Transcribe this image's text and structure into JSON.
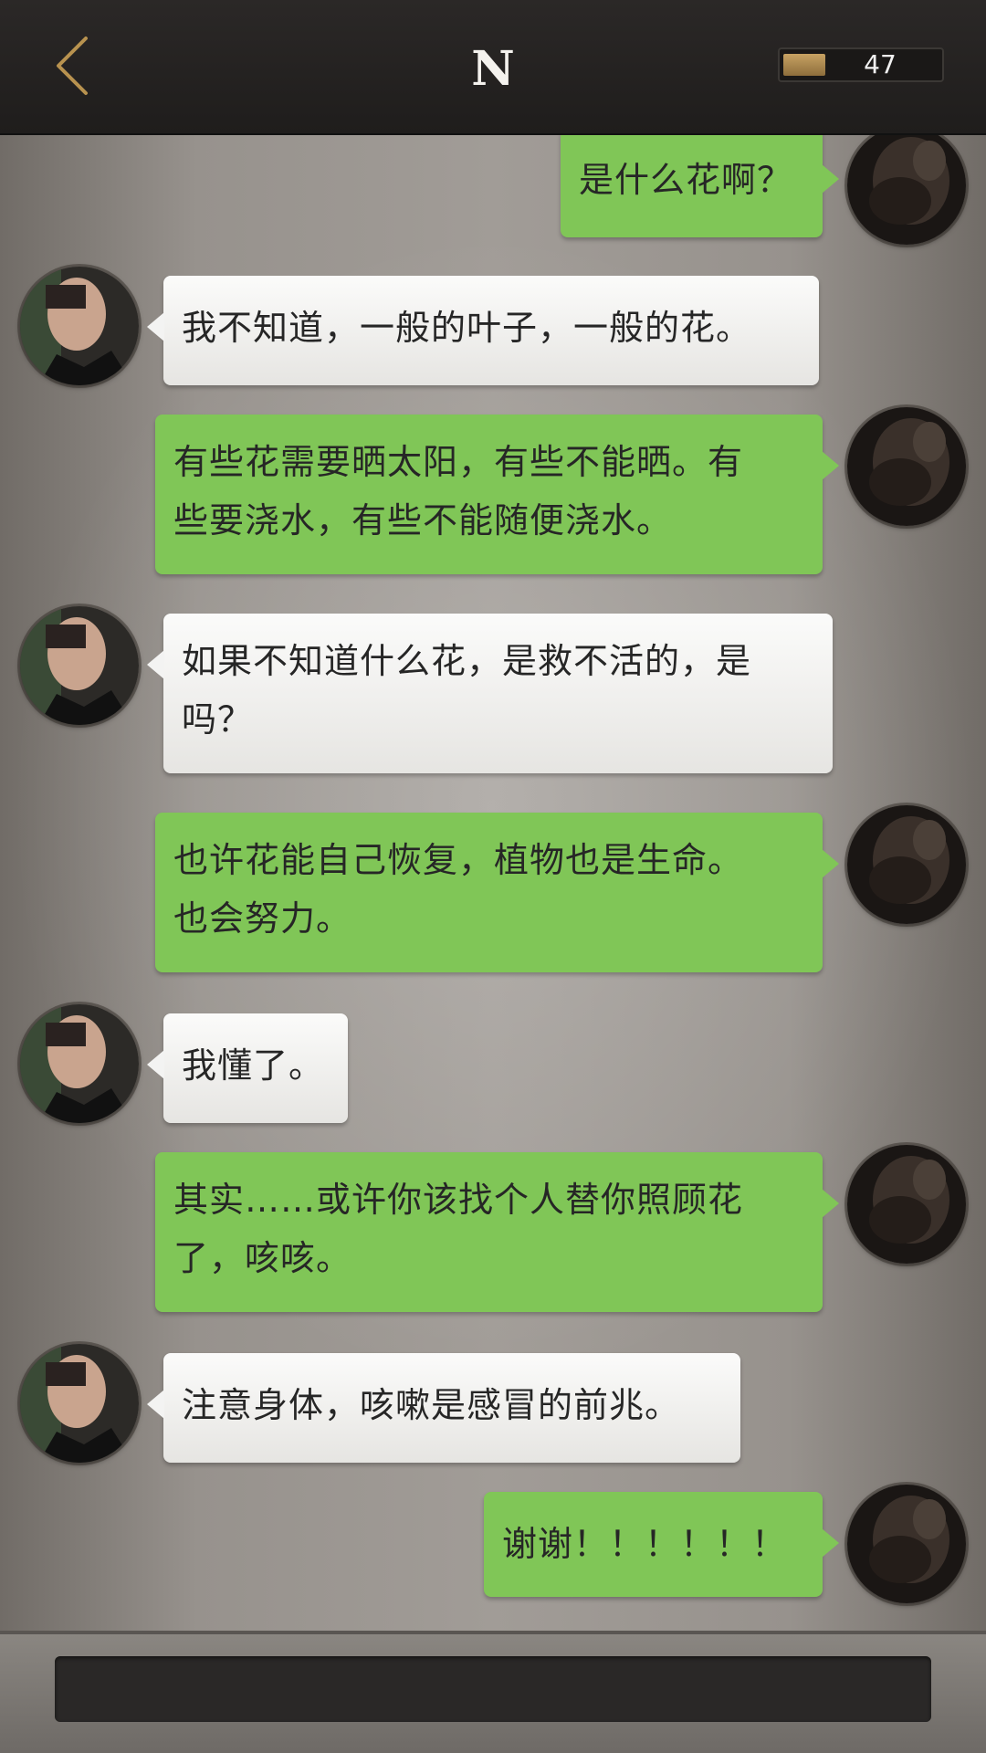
{
  "header": {
    "title": "N",
    "coins": "47"
  },
  "colors": {
    "my_bubble": "#80c657",
    "their_bubble": "#f3f3f2",
    "header_bg": "#1f1d1c",
    "back_arrow": "#b8924f"
  },
  "messages": [
    {
      "sender": "me",
      "lines": [
        "是什么花啊？"
      ]
    },
    {
      "sender": "them",
      "lines": [
        "我不知道，一般的叶子，一般的花。"
      ]
    },
    {
      "sender": "me",
      "lines": [
        "有些花需要晒太阳，有些不能晒。有",
        "些要浇水，有些不能随便浇水。"
      ]
    },
    {
      "sender": "them",
      "lines": [
        "如果不知道什么花，是救不活的，是",
        "吗？"
      ]
    },
    {
      "sender": "me",
      "lines": [
        "也许花能自己恢复，植物也是生命。",
        "也会努力。"
      ]
    },
    {
      "sender": "them",
      "lines": [
        "我懂了。"
      ]
    },
    {
      "sender": "me",
      "lines": [
        "其实……或许你该找个人替你照顾花",
        "了，咳咳。"
      ]
    },
    {
      "sender": "them",
      "lines": [
        "注意身体，咳嗽是感冒的前兆。"
      ]
    },
    {
      "sender": "me",
      "lines": [
        "谢谢！！！！！！"
      ]
    }
  ],
  "input": {
    "placeholder": ""
  }
}
